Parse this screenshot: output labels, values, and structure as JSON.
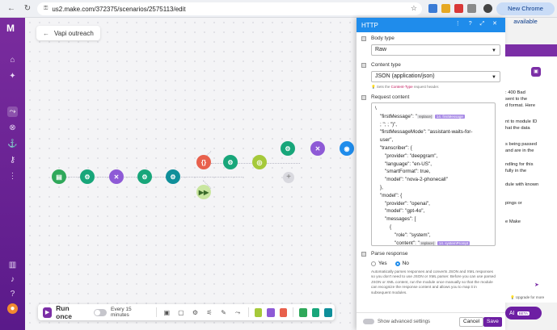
{
  "browser": {
    "url": "us2.make.com/372375/scenarios/2575113/edit",
    "update_label": "New Chrome available"
  },
  "sidebar": {
    "logo": "M"
  },
  "canvas": {
    "scenario_name": "Vapi outreach",
    "modules": [
      {
        "color": "#2fa85a",
        "glyph": "▤"
      },
      {
        "color": "#18a67a",
        "glyph": "⚙"
      },
      {
        "color": "#8e5ad6",
        "glyph": "✕"
      },
      {
        "color": "#18a67a",
        "glyph": "⚙"
      },
      {
        "color": "#0f8f9a",
        "glyph": "⚙"
      },
      {
        "color": "#e8604c",
        "glyph": "{}"
      },
      {
        "color": "#18a67a",
        "glyph": "⚙"
      },
      {
        "color": "#a5c93a",
        "glyph": "◎"
      },
      {
        "color": "#18a67a",
        "glyph": "⚙"
      },
      {
        "color": "#8e5ad6",
        "glyph": "✕"
      },
      {
        "color": "#1f8ceb",
        "glyph": "◉"
      }
    ],
    "plus": "+"
  },
  "toolbar": {
    "run_label": "Run once",
    "schedule": "Every 15 minutes"
  },
  "http_panel": {
    "title": "HTTP",
    "body_type_label": "Body type",
    "body_type_value": "Raw",
    "content_type_label": "Content type",
    "content_type_value": "JSON (application/json)",
    "content_type_hint_pre": "Sets the",
    "content_type_hint_pill": "Content-Type",
    "content_type_hint_post": "request header.",
    "request_content_label": "Request content",
    "code": {
      "l0": "\\",
      "l1a": "\"firstMessage\": \"",
      "l1tag": "replace(",
      "l1var": "14. firstMessage",
      "l2": ";   \"; ; \")\",",
      "l3": "\"firstMessageMode\": \"assistant-waits-for-",
      "l4": "user\",",
      "l5": "\"transcriber\": {",
      "l6": "\"provider\": \"deepgram\",",
      "l7": "\"language\": \"en-US\",",
      "l8": "\"smartFormat\": true,",
      "l9": "\"model\": \"nova-2-phonecall\"",
      "l10": "},",
      "l11": "\"model\": {",
      "l12": "\"provider\": \"openai\",",
      "l13": "\"model\": \"gpt-4o\",",
      "l14": "\"messages\": [",
      "l15": "{",
      "l16": "\"role\": \"system\",",
      "l17a": "\"content\": \"",
      "l17tag": "replace(",
      "l17var": "14. systemPrompt",
      "l18": "; \"; ; \")\""
    },
    "parse_response_label": "Parse response",
    "yes_label": "Yes",
    "no_label": "No",
    "parse_desc": "Automatically parses responses and converts JSON and XML responses so you don't need to use JSON or XML parser. Before you can use parsed JSON or XML content, run the module once manually so that the module can recognize the response content and allows you to map it in subsequent modules.",
    "advanced_label": "Show advanced settings",
    "cancel_label": "Cancel",
    "save_label": "Save"
  },
  "ai_panel": {
    "lines": [
      ": 400 Bad",
      "sent to the",
      "d format. Here",
      "",
      "nt to module ID",
      "hat the data",
      "",
      "s being passed",
      "and are in the",
      "",
      "ndling for this",
      "fully in the",
      "",
      "dule with known",
      "",
      "pings or",
      "",
      "e Make"
    ],
    "link": "Upgrade for more",
    "fab_label": "AI",
    "beta": "BETA"
  }
}
